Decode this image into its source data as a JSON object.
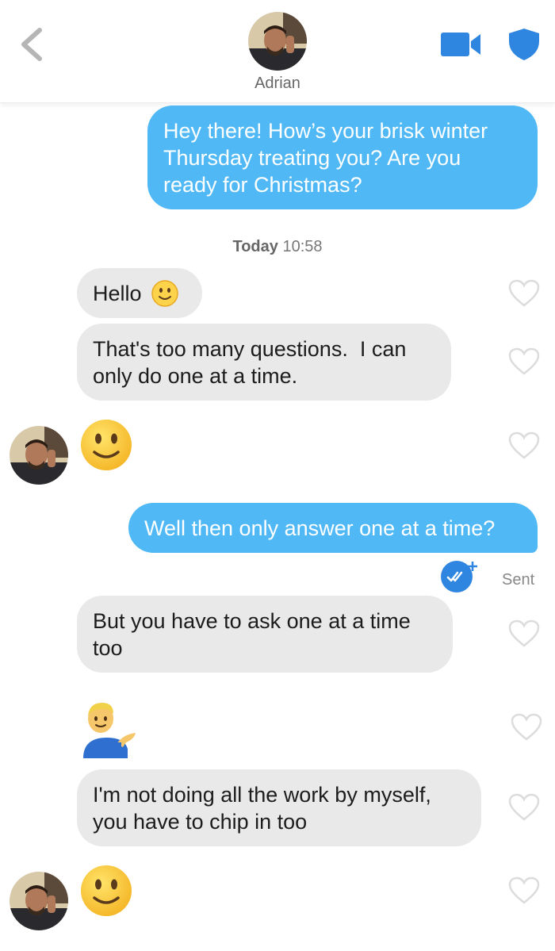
{
  "header": {
    "contact_name": "Adrian"
  },
  "timestamp": {
    "day": "Today",
    "time": "10:58"
  },
  "messages": [
    {
      "text": "Hey there! How’s your brisk winter\nThursday treating you? Are you\nready for Christmas?"
    },
    {
      "text": "Hello"
    },
    {
      "text": "That's too many questions.  I can\nonly do one at a time."
    },
    {
      "text": "Well then only answer one at a time?"
    },
    {
      "text": "But you have to ask one at a time\ntoo"
    },
    {
      "text": "I'm not doing all the work by myself,\nyou have to chip in too"
    }
  ],
  "status": {
    "sent_label": "Sent"
  },
  "icons": [
    "back-chevron-icon",
    "video-call-icon",
    "shield-icon",
    "heart-icon",
    "slightly-smiling-face-emoji",
    "man-tipping-hand-emoji",
    "read-receipt-check-icon"
  ],
  "colors": {
    "accent": "#2f86e0",
    "outgoing_bubble": "#4fb8f5",
    "incoming_bubble": "#e9e9ea"
  }
}
